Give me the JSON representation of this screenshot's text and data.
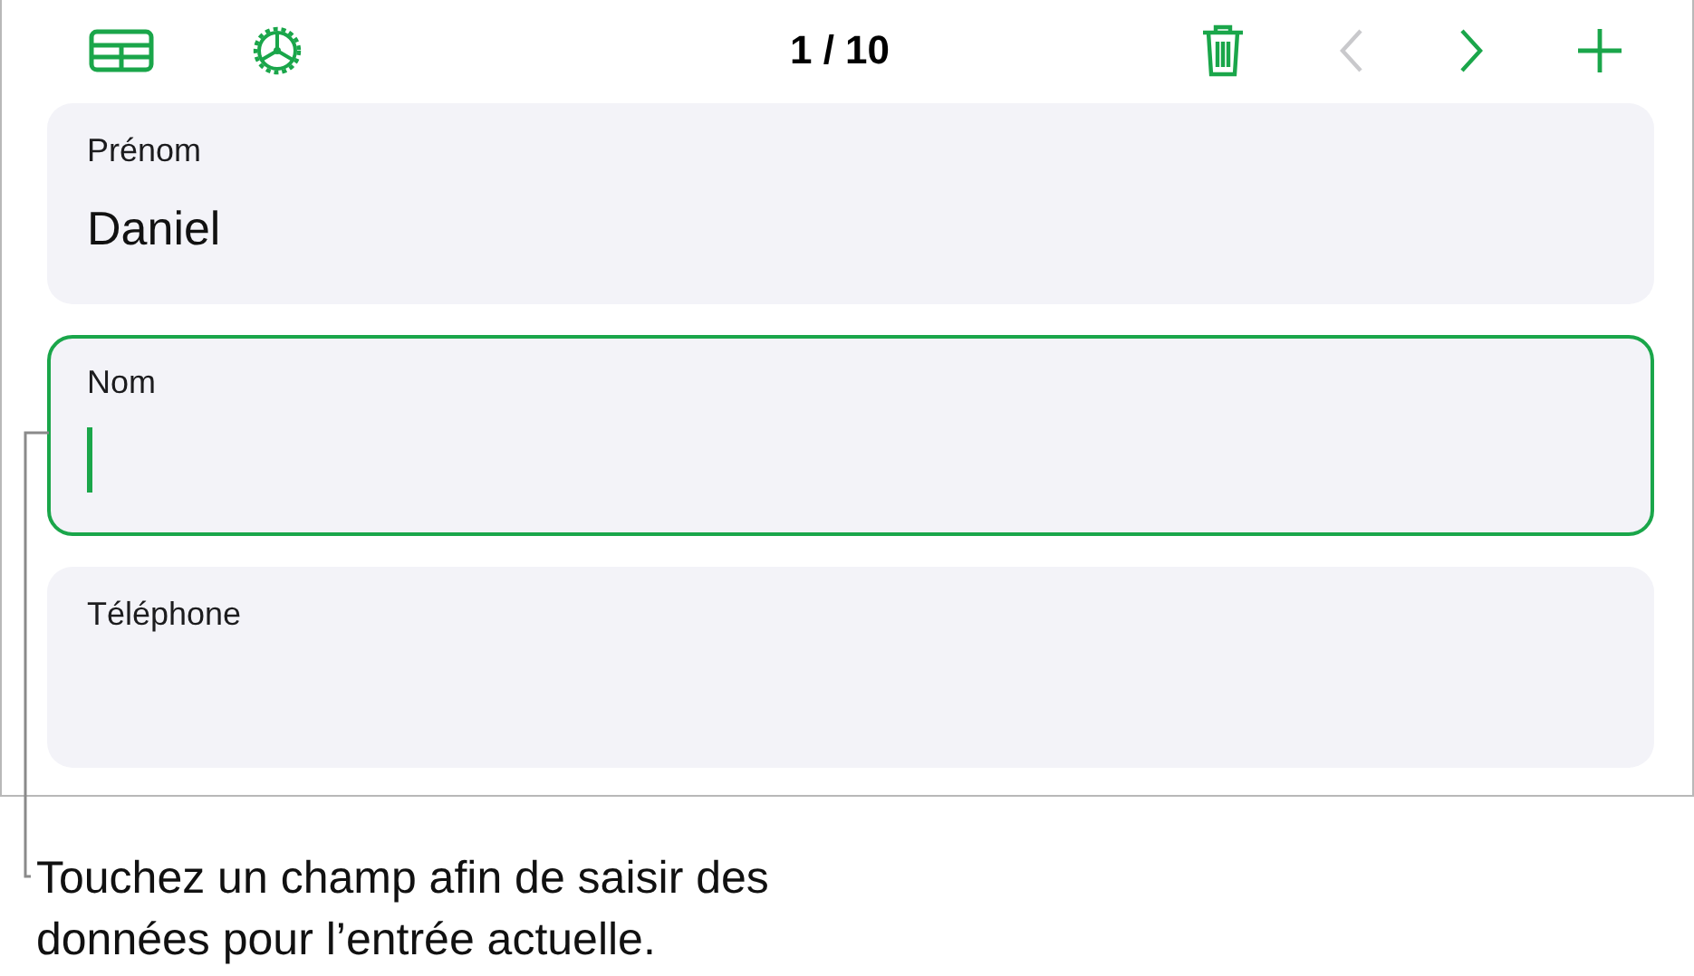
{
  "toolbar": {
    "counter": "1 / 10",
    "previous_disabled": true,
    "next_disabled": false
  },
  "fields": [
    {
      "label": "Prénom",
      "value": "Daniel",
      "focused": false
    },
    {
      "label": "Nom",
      "focused": true
    },
    {
      "label": "Téléphone",
      "focused": false
    }
  ],
  "callout": "Touchez un champ afin de saisir des données pour l’entrée actuelle."
}
